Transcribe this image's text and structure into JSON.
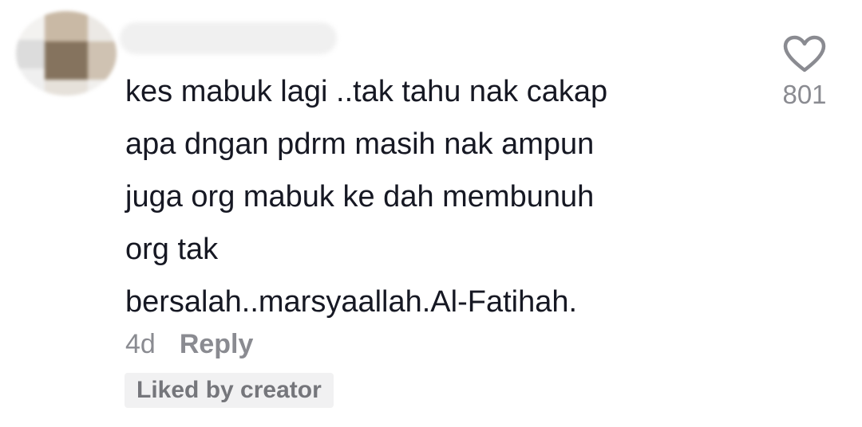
{
  "comment": {
    "text_lines": [
      "kes mabuk lagi ..tak tahu nak cakap",
      "apa dngan pdrm masih nak ampun",
      "juga org mabuk ke dah membunuh",
      "org tak",
      "bersalah..marsyaallah.Al-Fatihah."
    ],
    "timestamp": "4d",
    "reply_label": "Reply",
    "liked_by_label": "Liked by creator",
    "like_count": "801"
  },
  "icons": {
    "like": "heart-outline-icon"
  },
  "colors": {
    "text": "#161823",
    "muted": "#8a8b91",
    "badge_bg": "#f1f1f2"
  }
}
